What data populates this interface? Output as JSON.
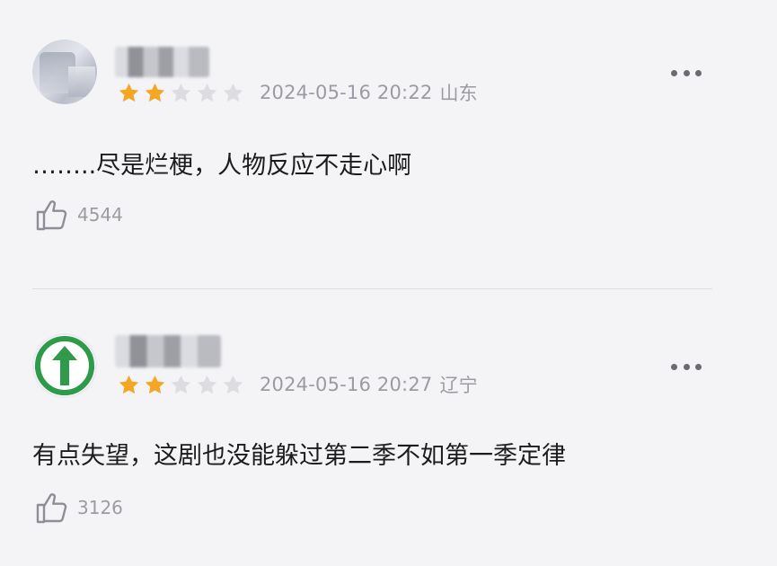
{
  "comments": [
    {
      "rating_filled": 2,
      "rating_total": 5,
      "date": "2024-05-16 20:22",
      "region": "山东",
      "text": "……..尽是烂梗，人物反应不走心啊",
      "likes": "4544"
    },
    {
      "rating_filled": 2,
      "rating_total": 5,
      "date": "2024-05-16 20:27",
      "region": "辽宁",
      "text": "有点失望，这剧也没能躲过第二季不如第一季定律",
      "likes": "3126"
    }
  ],
  "icons": {
    "star_filled": "star-icon",
    "star_empty": "star-outline-icon",
    "more": "more-icon",
    "like": "thumbs-up-icon",
    "avatar_logo": "green-arrow-logo"
  },
  "colors": {
    "star_filled": "#f5a623",
    "star_empty": "#dcdce1",
    "logo_green": "#2e9a4a"
  }
}
